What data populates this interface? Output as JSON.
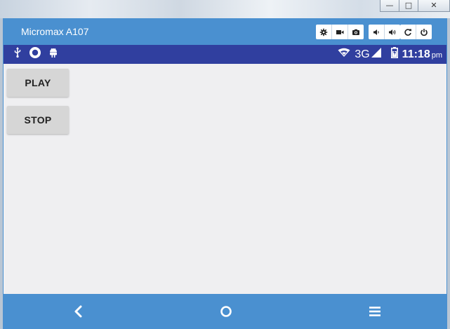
{
  "window": {
    "device_title": "Micromax A107",
    "controls": [
      "minimize",
      "maximize",
      "close"
    ]
  },
  "toolbar": {
    "icons": [
      "gear-icon",
      "video-icon",
      "camera-icon",
      "volume-down-icon",
      "volume-up-icon",
      "rotate-icon",
      "power-icon"
    ]
  },
  "statusbar": {
    "left_icons": [
      "usb-icon",
      "circle-icon",
      "android-icon"
    ],
    "network": "3G",
    "time": "11:18",
    "ampm": "pm"
  },
  "app": {
    "play_label": "PLAY",
    "stop_label": "STOP"
  },
  "navbar": {
    "icons": [
      "back-icon",
      "home-icon",
      "menu-icon"
    ]
  },
  "colors": {
    "frame_blue": "#4a90d0",
    "statusbar_indigo": "#303f9f",
    "content_bg": "#efeff1",
    "button_gray": "#d6d6d6"
  }
}
